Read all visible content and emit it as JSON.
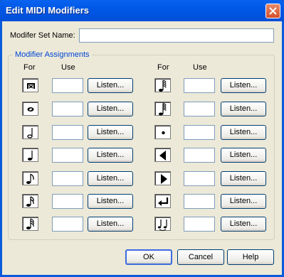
{
  "window": {
    "title": "Edit MIDI Modifiers"
  },
  "setname": {
    "label": "Modifer Set Name:",
    "value": ""
  },
  "group": {
    "title": "Modifier Assignments"
  },
  "columns": {
    "for": "For",
    "use": "Use"
  },
  "listen_label": "Listen...",
  "left_rows": [
    {
      "icon": "drum-beam-icon",
      "value": ""
    },
    {
      "icon": "whole-note-icon",
      "value": ""
    },
    {
      "icon": "half-note-icon",
      "value": ""
    },
    {
      "icon": "quarter-note-icon",
      "value": ""
    },
    {
      "icon": "eighth-note-icon",
      "value": ""
    },
    {
      "icon": "sixteenth-note-icon",
      "value": ""
    },
    {
      "icon": "thirty-second-note-icon",
      "value": ""
    }
  ],
  "right_rows": [
    {
      "icon": "sixty-fourth-note-icon",
      "value": ""
    },
    {
      "icon": "one-twenty-eighth-note-icon",
      "value": ""
    },
    {
      "icon": "dot-icon",
      "value": ""
    },
    {
      "icon": "left-arrow-icon",
      "value": ""
    },
    {
      "icon": "right-arrow-icon",
      "value": ""
    },
    {
      "icon": "enter-icon",
      "value": ""
    },
    {
      "icon": "tie-icon",
      "value": ""
    }
  ],
  "buttons": {
    "ok": "OK",
    "cancel": "Cancel",
    "help": "Help"
  }
}
